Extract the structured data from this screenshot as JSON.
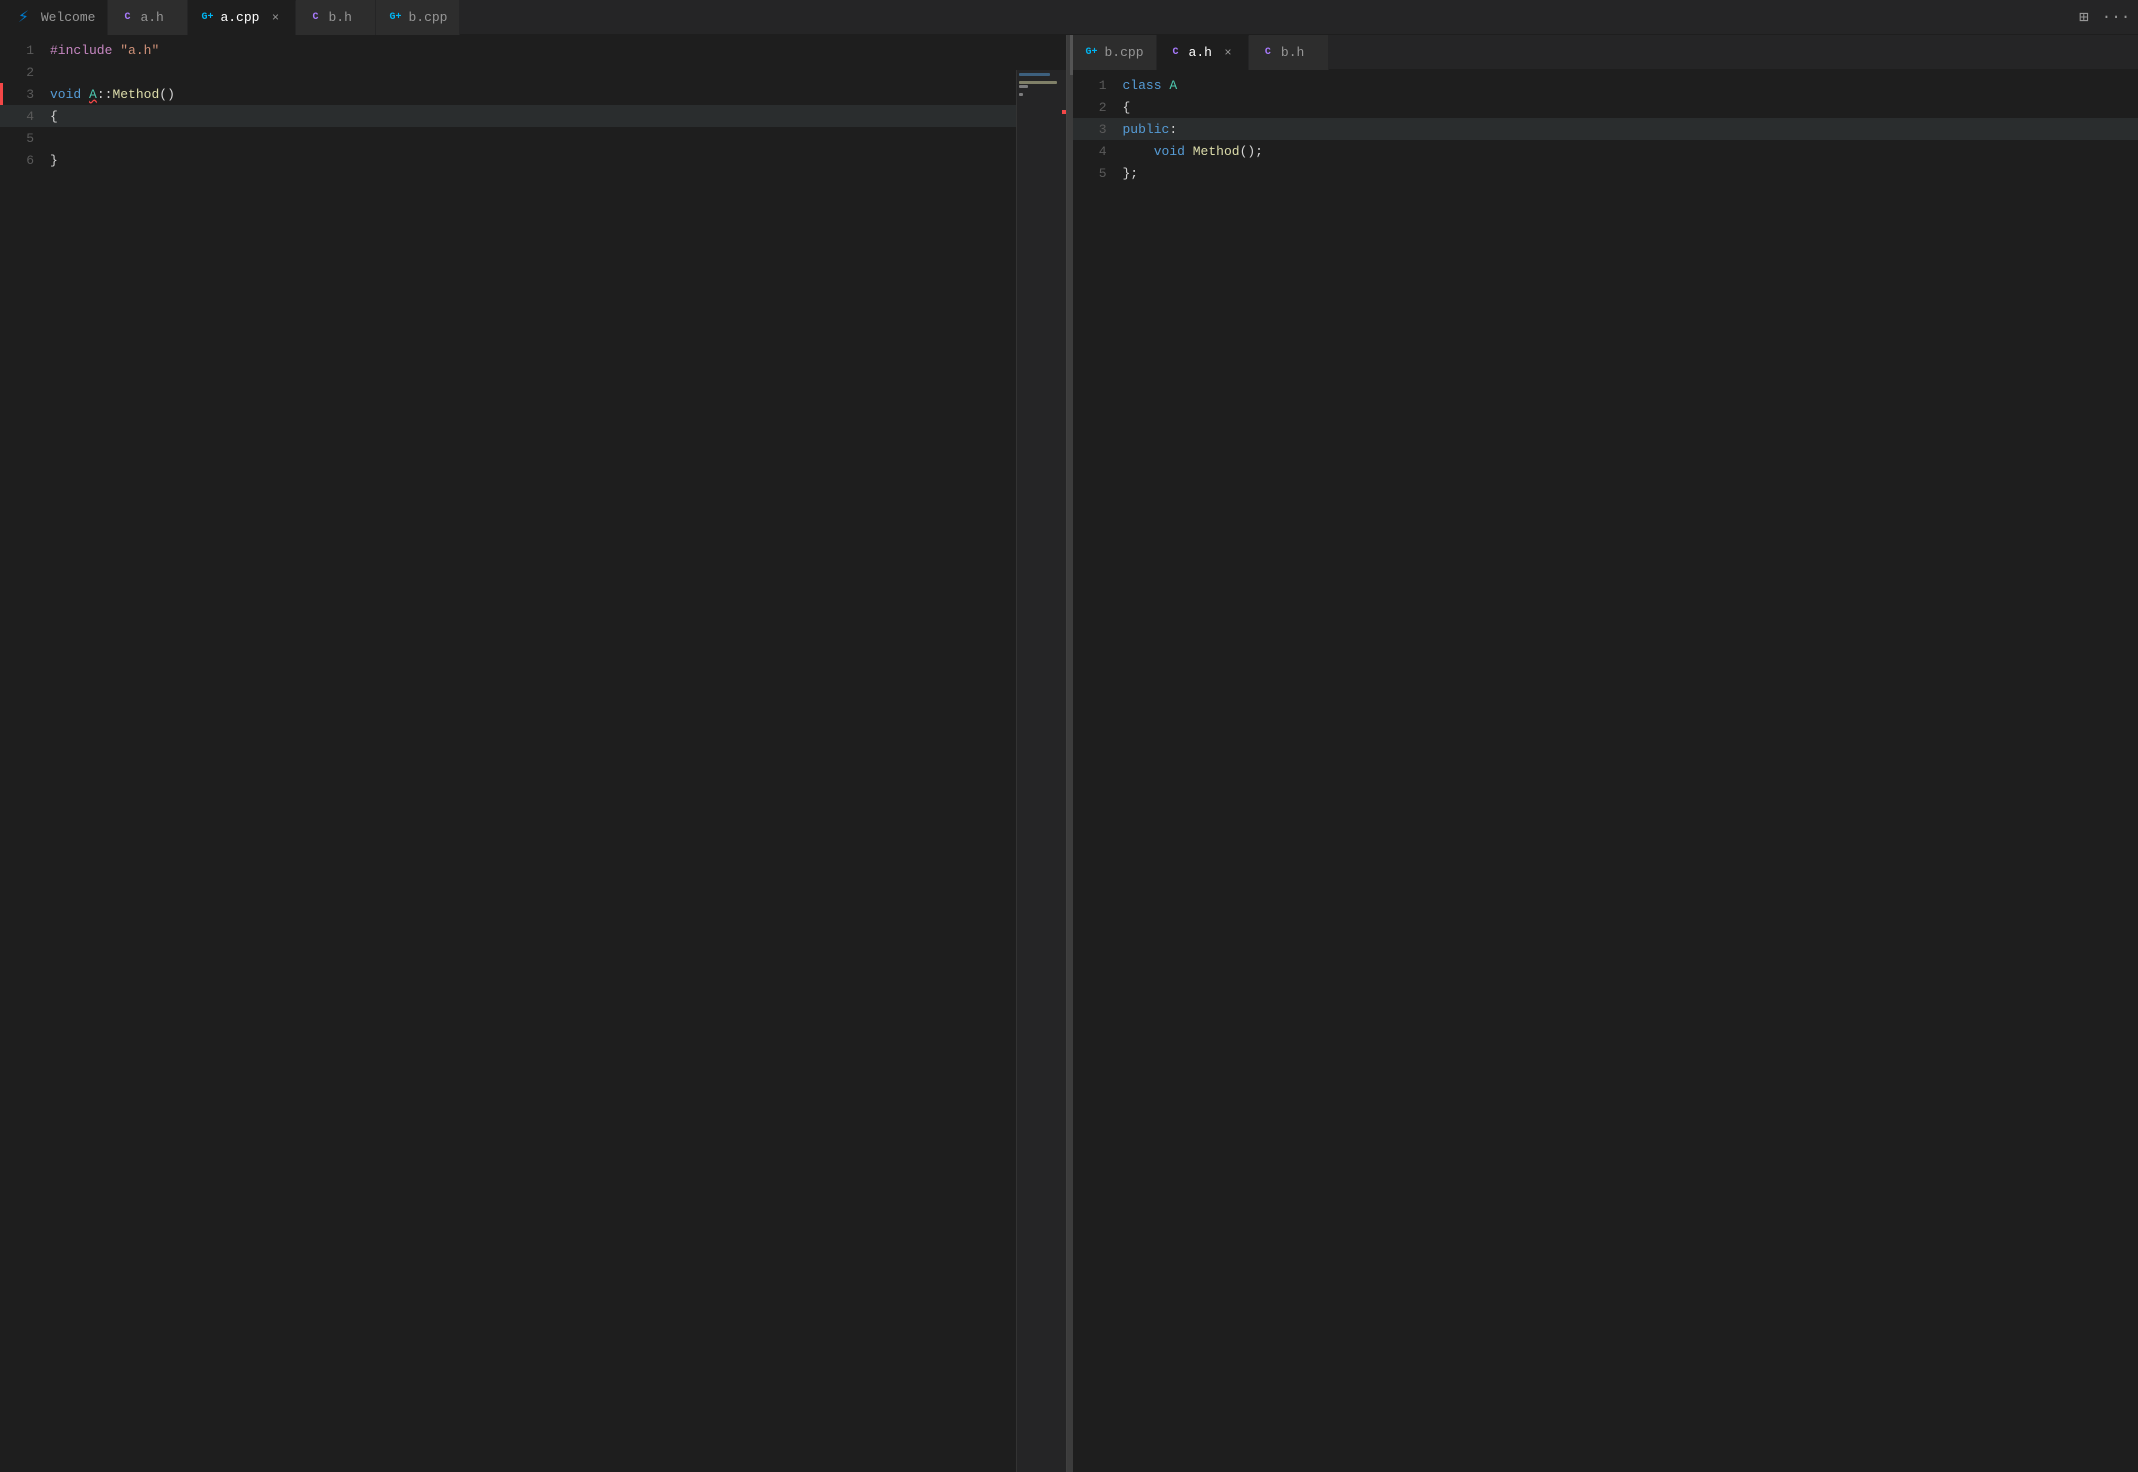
{
  "tabs_left": [
    {
      "id": "welcome",
      "label": "Welcome",
      "icon_type": "vscode",
      "active": false,
      "closable": false
    },
    {
      "id": "a_h",
      "label": "a.h",
      "icon_type": "h",
      "active": false,
      "closable": false
    },
    {
      "id": "a_cpp",
      "label": "a.cpp",
      "icon_type": "cpp",
      "active": true,
      "closable": true
    },
    {
      "id": "b_h",
      "label": "b.h",
      "icon_type": "h",
      "active": false,
      "closable": false
    },
    {
      "id": "b_cpp_left",
      "label": "b.cpp",
      "icon_type": "cpp",
      "active": false,
      "closable": false
    }
  ],
  "tabs_right": [
    {
      "id": "b_cpp_right",
      "label": "b.cpp",
      "icon_type": "cpp",
      "active": false,
      "closable": false
    },
    {
      "id": "a_h_right",
      "label": "a.h",
      "icon_type": "h",
      "active": true,
      "closable": true
    },
    {
      "id": "b_h_right",
      "label": "b.h",
      "icon_type": "h",
      "active": false,
      "closable": false
    }
  ],
  "left_code": [
    {
      "line": 1,
      "tokens": [
        {
          "t": "#include",
          "c": "kw-include"
        },
        {
          "t": " ",
          "c": "plain"
        },
        {
          "t": "\"a.h\"",
          "c": "str"
        }
      ]
    },
    {
      "line": 2,
      "tokens": []
    },
    {
      "line": 3,
      "tokens": [
        {
          "t": "void",
          "c": "kw-void"
        },
        {
          "t": " ",
          "c": "plain"
        },
        {
          "t": "A",
          "c": "class-name"
        },
        {
          "t": "::",
          "c": "punct"
        },
        {
          "t": "Method",
          "c": "func"
        },
        {
          "t": "()",
          "c": "punct"
        }
      ],
      "squiggly": true,
      "squiggly_start": 5,
      "error_decor": true
    },
    {
      "line": 4,
      "tokens": [
        {
          "t": "{",
          "c": "punct"
        }
      ],
      "active": true
    },
    {
      "line": 5,
      "tokens": []
    },
    {
      "line": 6,
      "tokens": [
        {
          "t": "}",
          "c": "punct"
        }
      ]
    }
  ],
  "right_code": [
    {
      "line": 1,
      "tokens": [
        {
          "t": "class",
          "c": "kw-class"
        },
        {
          "t": " ",
          "c": "plain"
        },
        {
          "t": "A",
          "c": "class-name"
        }
      ]
    },
    {
      "line": 2,
      "tokens": [
        {
          "t": "{",
          "c": "punct"
        }
      ]
    },
    {
      "line": 3,
      "tokens": [
        {
          "t": "public",
          "c": "kw-public"
        },
        {
          "t": ":",
          "c": "punct"
        }
      ],
      "active": true
    },
    {
      "line": 4,
      "tokens": [
        {
          "t": "    ",
          "c": "plain"
        },
        {
          "t": "void",
          "c": "kw-void"
        },
        {
          "t": " ",
          "c": "plain"
        },
        {
          "t": "Method",
          "c": "func"
        },
        {
          "t": "();",
          "c": "punct"
        }
      ]
    },
    {
      "line": 5,
      "tokens": [
        {
          "t": "};",
          "c": "punct"
        }
      ]
    }
  ],
  "split_icon": "⊞",
  "more_icon": "···",
  "close_x": "×"
}
